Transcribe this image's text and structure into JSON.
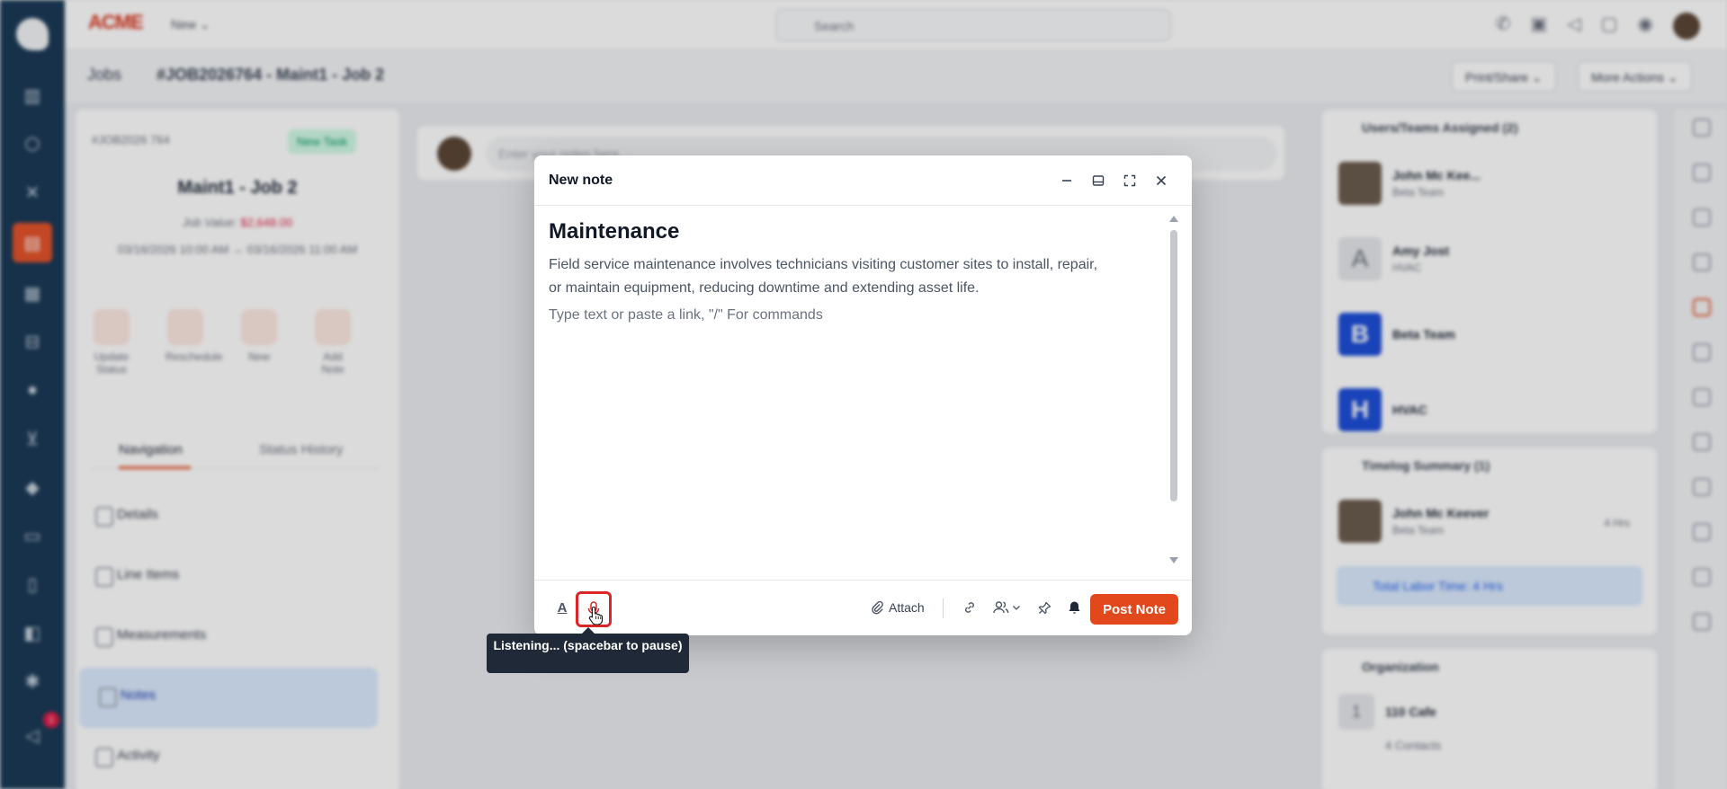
{
  "topbar": {
    "brand": "ACME",
    "new_label": "New",
    "search_placeholder": "Search"
  },
  "breadcrumb": {
    "root": "Jobs",
    "current": "#JOB2026764 - Maint1 - Job 2",
    "print_share": "Print/Share",
    "more_actions": "More Actions"
  },
  "job": {
    "number": "#JOB2026 764",
    "status": "New Task",
    "title": "Maint1 - Job 2",
    "value_label": "Job Value:",
    "value": "$2,648.00",
    "dates": "03/16/2026 10:00 AM → 03/16/2026 11:00 AM",
    "actions": [
      "Update Status",
      "Reschedule",
      "New",
      "Add Note"
    ]
  },
  "left_tabs": [
    "Navigation",
    "Status History"
  ],
  "nav_items": [
    "Details",
    "Line Items",
    "Measurements",
    "Notes",
    "Activity"
  ],
  "note_bar": {
    "placeholder": "Enter your notes here..."
  },
  "right": {
    "assigned_title": "Users/Teams Assigned (2)",
    "assigned": [
      {
        "name": "John Mc Kee...",
        "sub": "Beta Team",
        "initial": ""
      },
      {
        "name": "Amy Jost",
        "sub": "HVAC",
        "initial": "A"
      },
      {
        "name": "Beta Team",
        "sub": "",
        "initial": "B"
      },
      {
        "name": "HVAC",
        "sub": "",
        "initial": "H"
      }
    ],
    "timelog_title": "Timelog Summary (1)",
    "timelog_person": "John Mc Keever",
    "timelog_team": "Beta Team",
    "timelog_hours": "4 Hrs",
    "labor": "Total Labor Time: 4 Hrs",
    "org_title": "Organization",
    "org_name": "110 Cafe",
    "org_contacts": "4 Contacts"
  },
  "modal": {
    "title": "New note",
    "heading": "Maintenance",
    "paragraph": "Field service maintenance involves technicians visiting customer sites to install, repair, or maintain equipment, reducing downtime and extending asset life.",
    "placeholder": "Type text or paste a link, \"/\" For commands",
    "text_format_label": "A",
    "attach_label": "Attach",
    "post_label": "Post Note"
  },
  "tooltip": "Listening... (spacebar to pause)",
  "colors": {
    "accent": "#e3481c",
    "nav_bg": "#1b3a57",
    "mic_border": "#dc2626"
  }
}
